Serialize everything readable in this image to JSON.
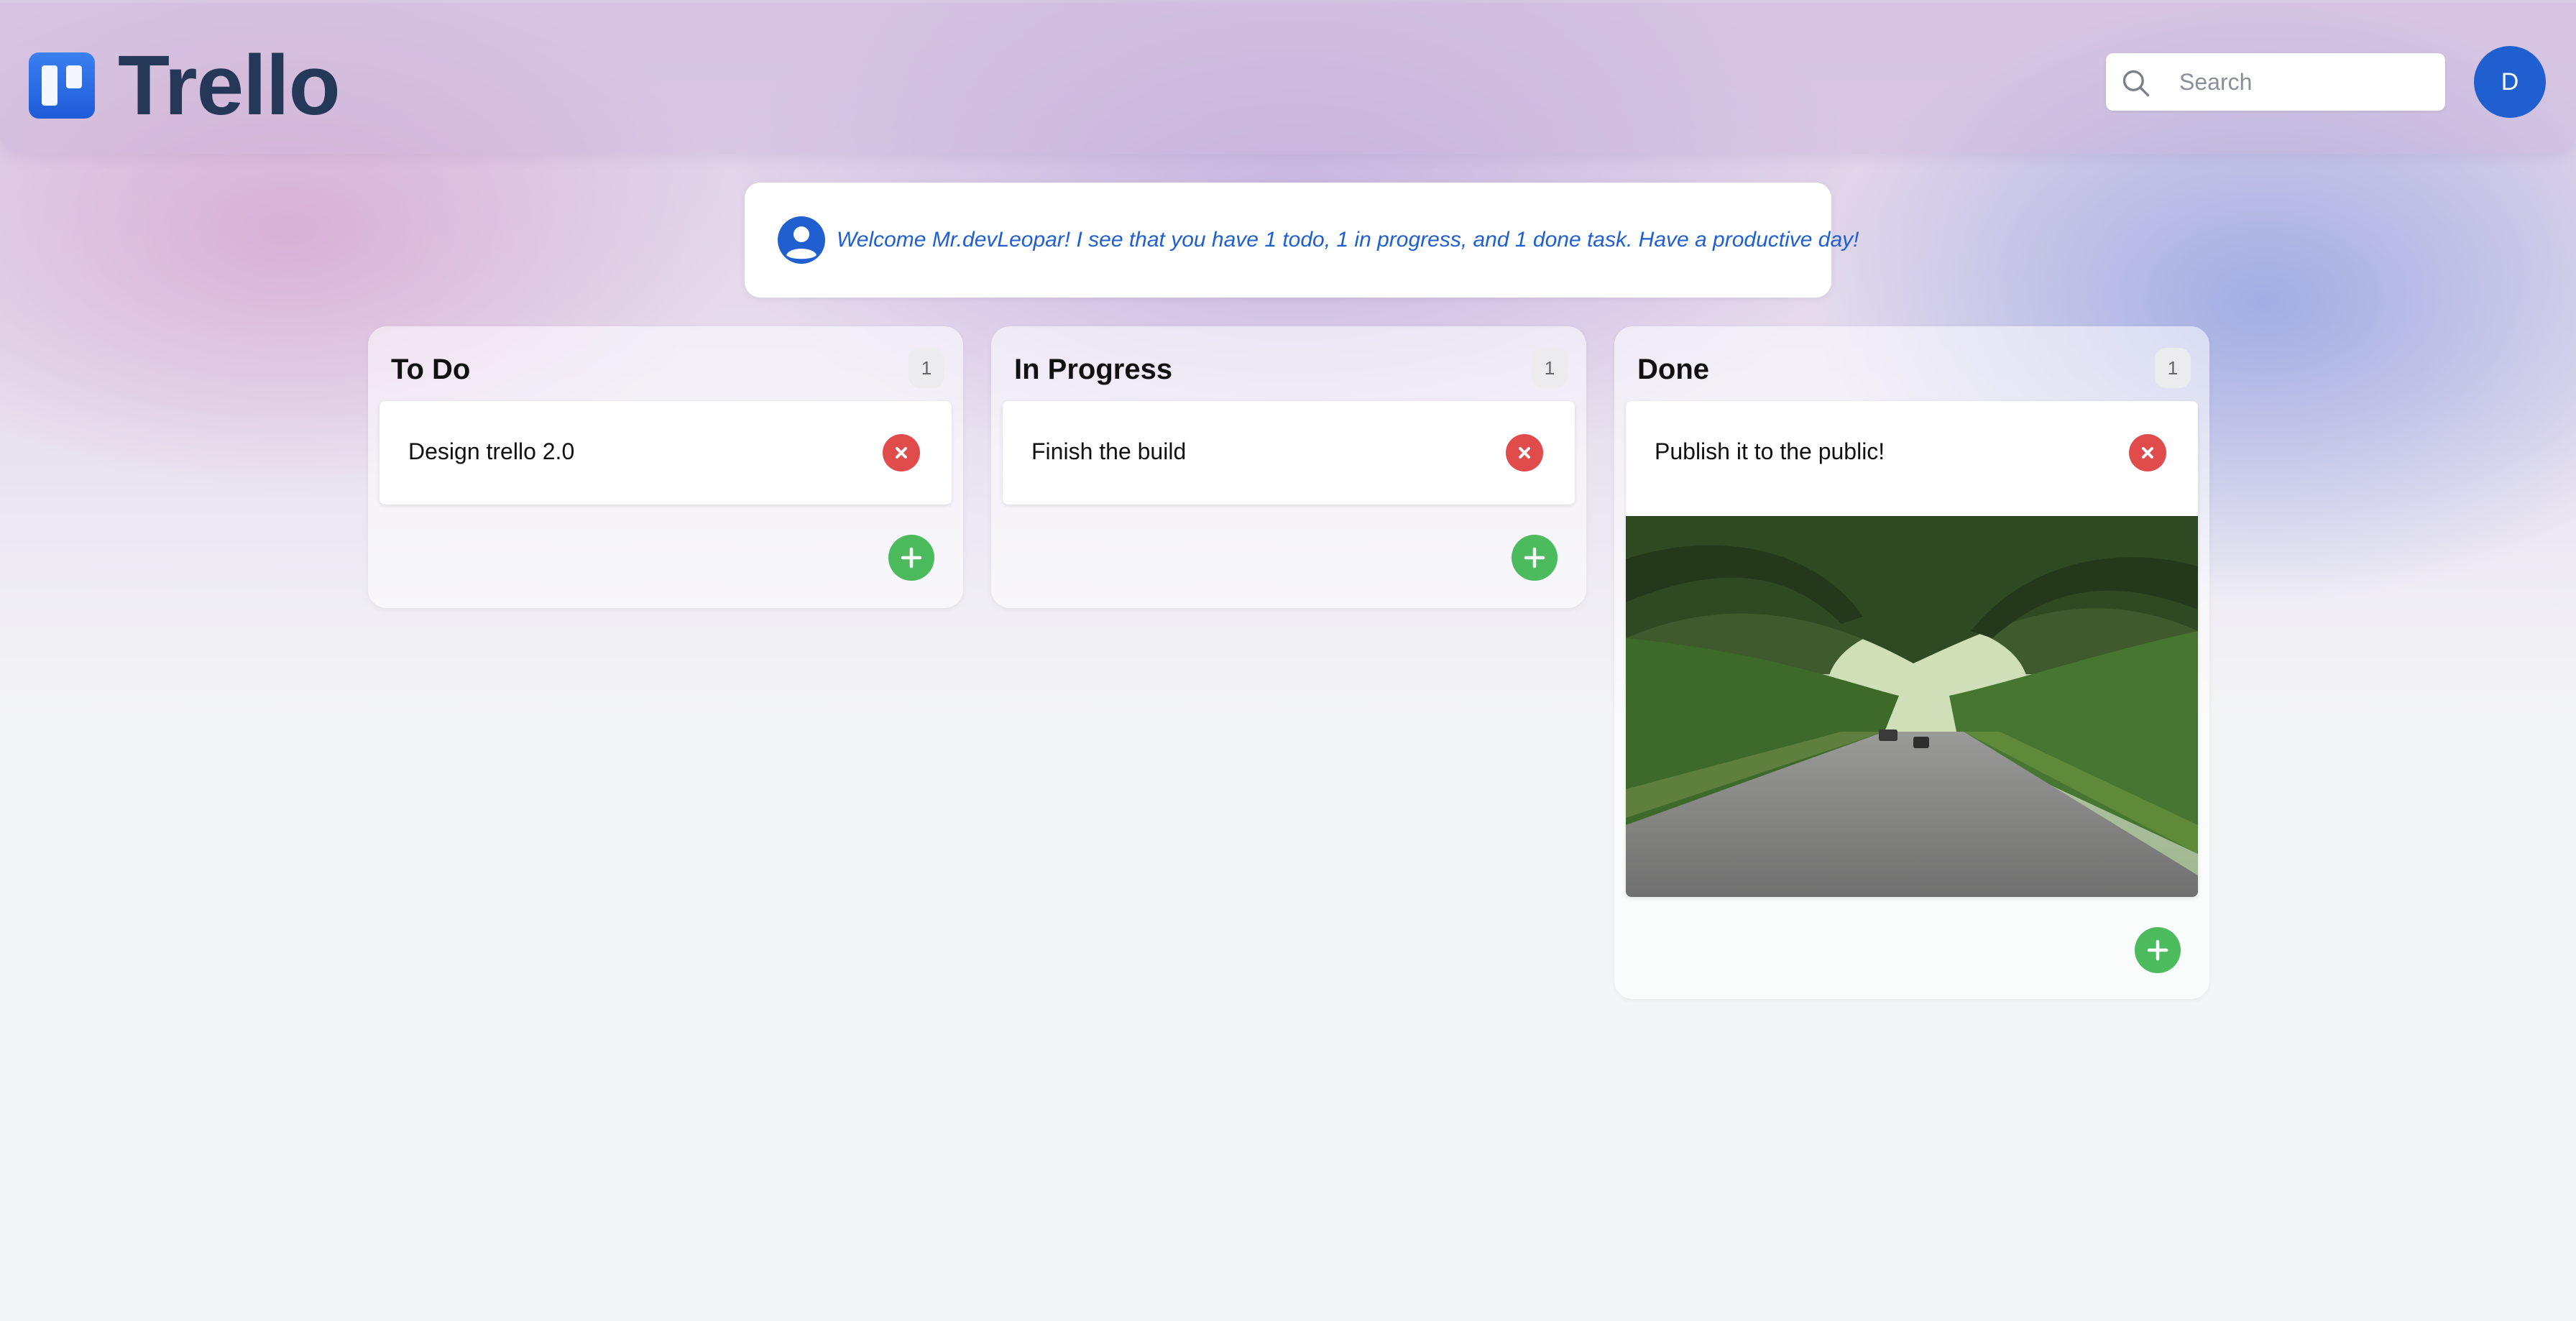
{
  "header": {
    "app_title": "Trello",
    "search_placeholder": "Search",
    "avatar_initial": "D"
  },
  "welcome": {
    "message": "Welcome Mr.devLeopar! I see that you have 1 todo, 1 in progress, and 1 done task. Have a productive day!"
  },
  "columns": [
    {
      "title": "To Do",
      "count": "1",
      "cards": [
        {
          "title": "Design trello 2.0",
          "has_image": false
        }
      ]
    },
    {
      "title": "In Progress",
      "count": "1",
      "cards": [
        {
          "title": "Finish the build",
          "has_image": false
        }
      ]
    },
    {
      "title": "Done",
      "count": "1",
      "cards": [
        {
          "title": "Publish it to the public!",
          "has_image": true
        }
      ]
    }
  ],
  "colors": {
    "accent": "#1f5fd0",
    "delete": "#e04b4b",
    "add": "#4cbb5e",
    "logo_text": "#253858"
  },
  "icons": {
    "logo": "trello-logo-icon",
    "search": "search-icon",
    "user": "user-circle-icon",
    "delete": "close-icon",
    "add": "plus-icon"
  }
}
